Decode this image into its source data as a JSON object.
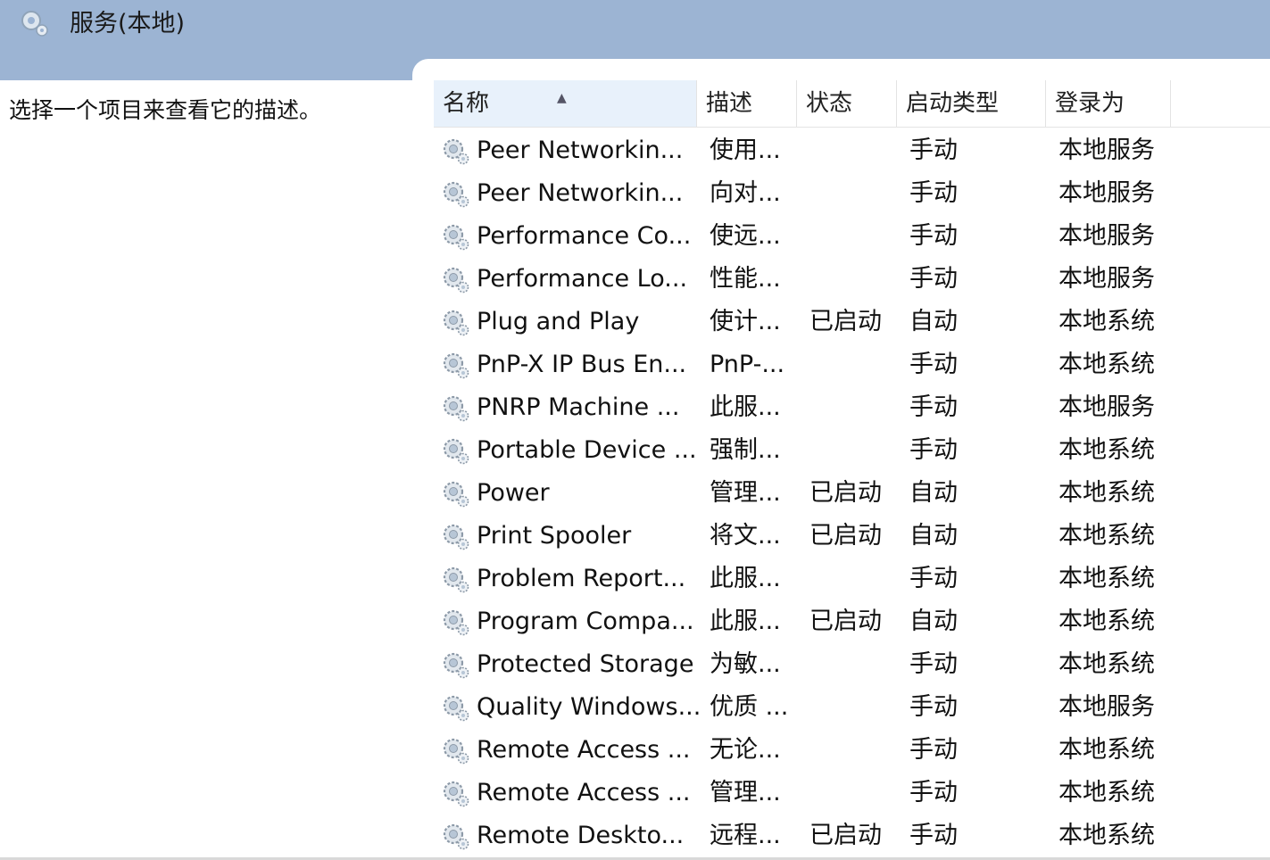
{
  "header": {
    "title": "服务(本地)",
    "icon": "services-gear-icon"
  },
  "description_panel": {
    "text": "选择一个项目来查看它的描述。"
  },
  "table": {
    "columns": [
      {
        "key": "name",
        "label": "名称",
        "sorted": "ascending"
      },
      {
        "key": "desc",
        "label": "描述"
      },
      {
        "key": "status",
        "label": "状态"
      },
      {
        "key": "startup",
        "label": "启动类型"
      },
      {
        "key": "logon",
        "label": "登录为"
      }
    ],
    "rows": [
      {
        "name": "Peer Networkin...",
        "desc": "使用...",
        "status": "",
        "startup": "手动",
        "logon": "本地服务"
      },
      {
        "name": "Peer Networkin...",
        "desc": "向对...",
        "status": "",
        "startup": "手动",
        "logon": "本地服务"
      },
      {
        "name": "Performance Co...",
        "desc": "使远...",
        "status": "",
        "startup": "手动",
        "logon": "本地服务"
      },
      {
        "name": "Performance Lo...",
        "desc": "性能...",
        "status": "",
        "startup": "手动",
        "logon": "本地服务"
      },
      {
        "name": "Plug and Play",
        "desc": "使计...",
        "status": "已启动",
        "startup": "自动",
        "logon": "本地系统"
      },
      {
        "name": "PnP-X IP Bus En...",
        "desc": "PnP-...",
        "status": "",
        "startup": "手动",
        "logon": "本地系统"
      },
      {
        "name": "PNRP Machine ...",
        "desc": "此服...",
        "status": "",
        "startup": "手动",
        "logon": "本地服务"
      },
      {
        "name": "Portable Device ...",
        "desc": "强制...",
        "status": "",
        "startup": "手动",
        "logon": "本地系统"
      },
      {
        "name": "Power",
        "desc": "管理...",
        "status": "已启动",
        "startup": "自动",
        "logon": "本地系统"
      },
      {
        "name": "Print Spooler",
        "desc": "将文...",
        "status": "已启动",
        "startup": "自动",
        "logon": "本地系统"
      },
      {
        "name": "Problem Report...",
        "desc": "此服...",
        "status": "",
        "startup": "手动",
        "logon": "本地系统"
      },
      {
        "name": "Program Compa...",
        "desc": "此服...",
        "status": "已启动",
        "startup": "自动",
        "logon": "本地系统"
      },
      {
        "name": "Protected Storage",
        "desc": "为敏...",
        "status": "",
        "startup": "手动",
        "logon": "本地系统"
      },
      {
        "name": "Quality Windows...",
        "desc": "优质 ...",
        "status": "",
        "startup": "手动",
        "logon": "本地服务"
      },
      {
        "name": "Remote Access ...",
        "desc": "无论...",
        "status": "",
        "startup": "手动",
        "logon": "本地系统"
      },
      {
        "name": "Remote Access ...",
        "desc": "管理...",
        "status": "",
        "startup": "手动",
        "logon": "本地系统"
      },
      {
        "name": "Remote Deskto...",
        "desc": "远程...",
        "status": "已启动",
        "startup": "手动",
        "logon": "本地系统"
      }
    ]
  }
}
